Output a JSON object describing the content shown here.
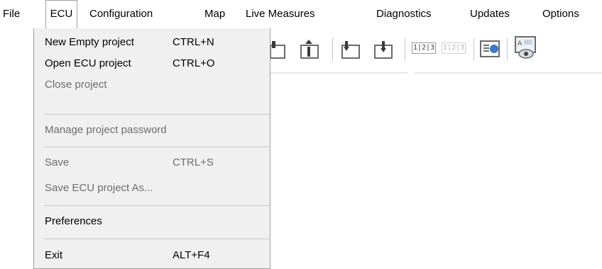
{
  "menubar": {
    "items": [
      {
        "label": "File"
      },
      {
        "label": "ECU"
      },
      {
        "label": "Configuration"
      },
      {
        "label": "Map"
      },
      {
        "label": "Live Measures"
      },
      {
        "label": "Diagnostics"
      },
      {
        "label": "Updates"
      },
      {
        "label": "Options"
      }
    ]
  },
  "file_menu": {
    "new_project": {
      "label": "New Empty project",
      "shortcut": "CTRL+N"
    },
    "open_project": {
      "label": "Open ECU project",
      "shortcut": "CTRL+O"
    },
    "close_project": {
      "label": "Close project"
    },
    "manage_password": {
      "label": "Manage project password"
    },
    "save": {
      "label": "Save",
      "shortcut": "CTRL+S"
    },
    "save_as": {
      "label": "Save ECU project As..."
    },
    "preferences": {
      "label": "Preferences"
    },
    "exit": {
      "label": "Exit",
      "shortcut": "ALT+F4"
    }
  },
  "toolbar": {
    "numbers_label_active": "1|2|3",
    "numbers_label_inactive": "1|2|3"
  },
  "colors": {
    "menu_bg": "#f0f0f0",
    "disabled_text": "#6d6d6d",
    "separator": "#c8c8c8",
    "icon_gray": "#6a6a6a",
    "icon_blue": "#3a78c8"
  }
}
